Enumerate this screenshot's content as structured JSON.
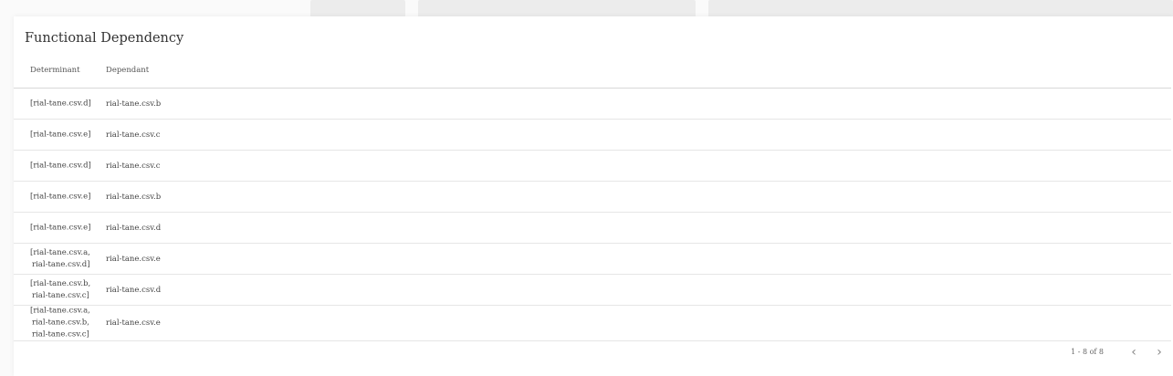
{
  "dialog": {
    "title": "Functional Dependency",
    "headers": {
      "determinant": "Determinant",
      "dependant": "Dependant"
    },
    "rows": [
      {
        "determinant": [
          "[rial-tane.csv.d]"
        ],
        "dependant": "rial-tane.csv.b"
      },
      {
        "determinant": [
          "[rial-tane.csv.e]"
        ],
        "dependant": "rial-tane.csv.c"
      },
      {
        "determinant": [
          "[rial-tane.csv.d]"
        ],
        "dependant": "rial-tane.csv.c"
      },
      {
        "determinant": [
          "[rial-tane.csv.e]"
        ],
        "dependant": "rial-tane.csv.b"
      },
      {
        "determinant": [
          "[rial-tane.csv.e]"
        ],
        "dependant": "rial-tane.csv.d"
      },
      {
        "determinant": [
          "[rial-tane.csv.a,",
          "rial-tane.csv.d]"
        ],
        "dependant": "rial-tane.csv.e"
      },
      {
        "determinant": [
          "[rial-tane.csv.b,",
          "rial-tane.csv.c]"
        ],
        "dependant": "rial-tane.csv.d"
      },
      {
        "determinant": [
          "[rial-tane.csv.a,",
          "rial-tane.csv.b,",
          "rial-tane.csv.c]"
        ],
        "dependant": "rial-tane.csv.e"
      }
    ],
    "pagination": {
      "range": "1 - 8 of 8",
      "prev_icon": "chevron-left-icon",
      "next_icon": "chevron-right-icon"
    }
  }
}
